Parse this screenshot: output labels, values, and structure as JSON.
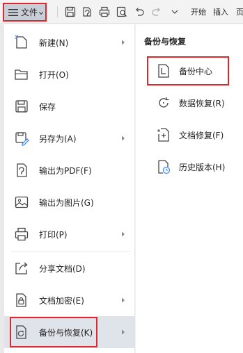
{
  "toolbar": {
    "file_label": "文件",
    "tab_start": "开始",
    "tab_insert": "插入",
    "tab_page_partial": "页"
  },
  "menu": {
    "items": [
      {
        "label": "新建(N)",
        "icon": "new-doc-icon",
        "has_submenu": true
      },
      {
        "label": "打开(O)",
        "icon": "folder-open-icon",
        "has_submenu": false
      },
      {
        "label": "保存",
        "icon": "save-icon",
        "has_submenu": false
      },
      {
        "label": "另存为(A)",
        "icon": "save-as-icon",
        "has_submenu": true
      },
      {
        "label": "输出为PDF(F)",
        "icon": "export-pdf-icon",
        "has_submenu": false
      },
      {
        "label": "输出为图片(G)",
        "icon": "export-image-icon",
        "has_submenu": false
      },
      {
        "label": "打印(P)",
        "icon": "print-icon",
        "has_submenu": true
      },
      {
        "label": "分享文档(D)",
        "icon": "share-icon",
        "has_submenu": false
      },
      {
        "label": "文档加密(E)",
        "icon": "encrypt-icon",
        "has_submenu": true
      },
      {
        "label": "备份与恢复(K)",
        "icon": "backup-restore-icon",
        "has_submenu": true,
        "active": true
      }
    ]
  },
  "submenu": {
    "title": "备份与恢复",
    "items": [
      {
        "label": "备份中心",
        "icon": "backup-center-icon"
      },
      {
        "label": "数据恢复(R)",
        "icon": "data-recovery-icon"
      },
      {
        "label": "文档修复(F)",
        "icon": "doc-repair-icon"
      },
      {
        "label": "历史版本(H)",
        "icon": "history-version-icon"
      }
    ]
  },
  "colors": {
    "highlight_border": "#e0272b",
    "active_row_bg": "#dfe3ea",
    "file_button_bg": "#c9ced6"
  }
}
